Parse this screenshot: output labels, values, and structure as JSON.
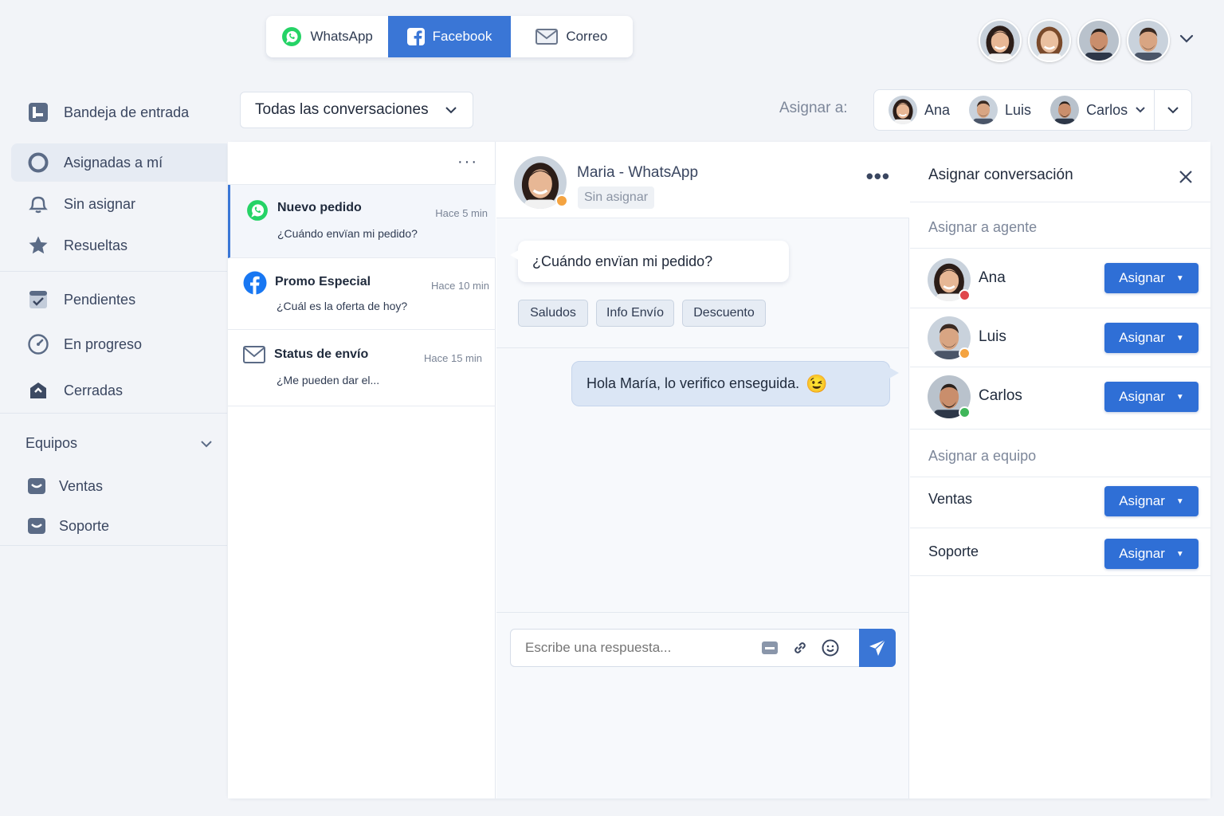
{
  "channels": [
    {
      "label": "WhatsApp",
      "icon": "whatsapp-icon",
      "active": false
    },
    {
      "label": "Facebook",
      "icon": "facebook-icon",
      "active": true
    },
    {
      "label": "Correo",
      "icon": "mail-icon",
      "active": false
    }
  ],
  "sidebar": {
    "items": [
      {
        "label": "Bandeja de entrada",
        "icon": "inbox-icon"
      },
      {
        "label": "Asignadas a mí",
        "icon": "circle-icon"
      },
      {
        "label": "Sin asignar",
        "icon": "bell-icon"
      },
      {
        "label": "Resueltas",
        "icon": "star-icon"
      },
      {
        "label": "Pendientes",
        "icon": "checkbox-icon"
      },
      {
        "label": "En progreso",
        "icon": "gauge-icon"
      },
      {
        "label": "Cerradas",
        "icon": "archive-icon"
      }
    ],
    "teams_title": "Equipos",
    "teams": [
      {
        "label": "Ventas",
        "icon": "folder-icon"
      },
      {
        "label": "Soporte",
        "icon": "folder-icon"
      }
    ]
  },
  "filter": {
    "label": "Todas las conversaciones"
  },
  "assign_bar": {
    "label": "Asignar a:",
    "agents": [
      "Ana",
      "Luis",
      "Carlos"
    ]
  },
  "conversations": [
    {
      "title": "Nuevo pedido",
      "time": "Hace 5 min",
      "preview": "¿Cuándo envïan mi pedido?",
      "channel": "whatsapp-icon"
    },
    {
      "title": "Promo Especial",
      "time": "Hace 10 min",
      "preview": "¿Cuál es la oferta de hoy?",
      "channel": "facebook-icon"
    },
    {
      "title": "Status de envío",
      "time": "Hace 15 min",
      "preview": "¿Me pueden dar el...",
      "channel": "mail-icon"
    }
  ],
  "chat": {
    "contact": "Maria - WhatsApp",
    "status": "Sin asignar",
    "incoming": "¿Cuándo envïan mi pedido?",
    "quick_replies": [
      "Saludos",
      "Info Envío",
      "Descuento"
    ],
    "outgoing": "Hola María, lo verifico enseguida.",
    "outgoing_emoji": "😉",
    "composer_placeholder": "Escribe una respuesta..."
  },
  "assign_panel": {
    "title": "Asignar conversación",
    "agents_title": "Asignar a agente",
    "agents": [
      {
        "name": "Ana",
        "status_color": "#e0474c"
      },
      {
        "name": "Luis",
        "status_color": "#f4a340"
      },
      {
        "name": "Carlos",
        "status_color": "#3fb65a"
      }
    ],
    "teams_title": "Asignar a equipo",
    "teams": [
      "Ventas",
      "Soporte"
    ],
    "button_label": "Asignar"
  },
  "colors": {
    "accent": "#3a76d6",
    "whatsapp": "#25d366",
    "facebook": "#1877f2"
  }
}
